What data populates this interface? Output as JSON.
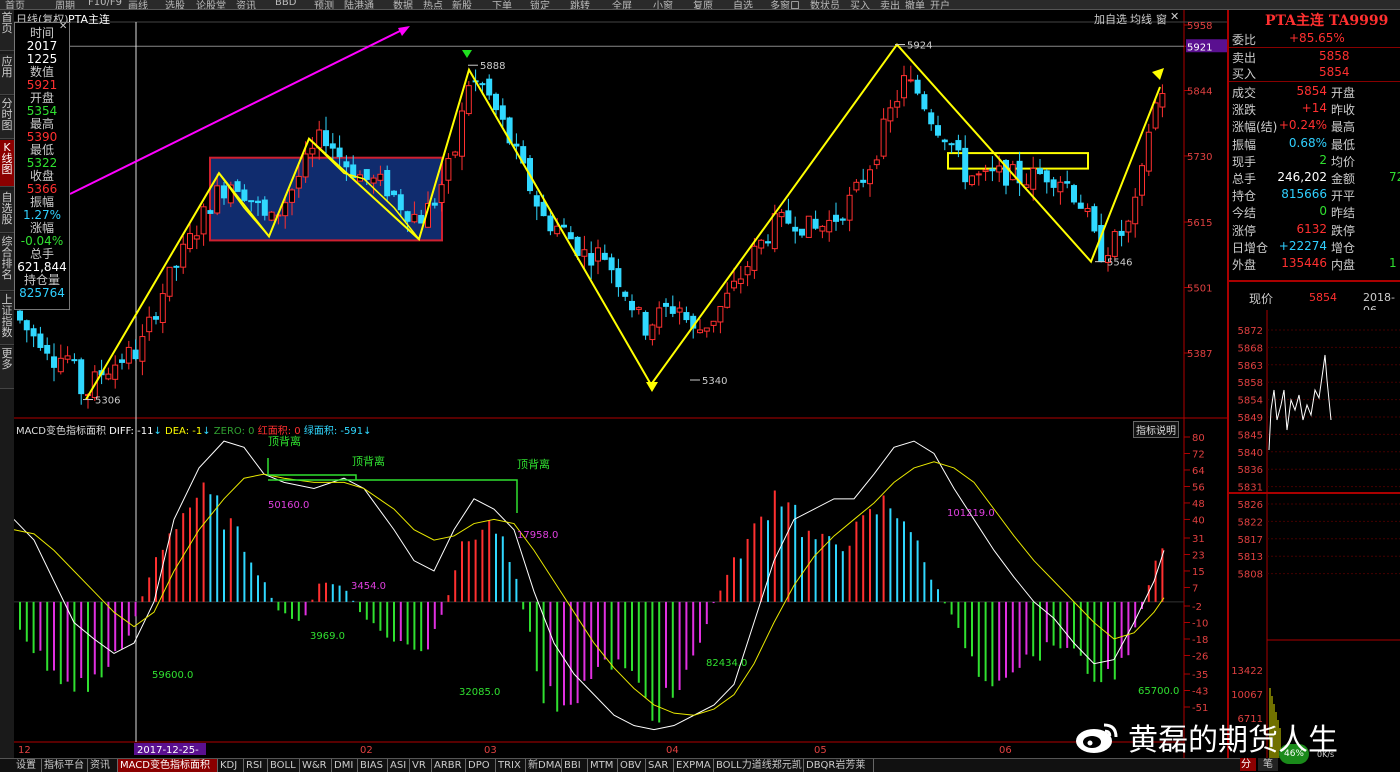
{
  "menubar": {
    "items": [
      "首页",
      "周期",
      "F10/F9",
      "画线",
      "选股",
      "论股堂",
      "资讯",
      "BBD",
      "预测",
      "陆港通",
      "数据",
      "热点",
      "新股",
      "下单",
      "锁定",
      "跳转",
      "全屏",
      "小窗",
      "复原",
      "自选",
      "多窗口",
      "数状员",
      "买入",
      "卖出",
      "撤单",
      "开户"
    ]
  },
  "leftnav": {
    "items": [
      "首页",
      "应用",
      "分时图",
      "K线图",
      "自选股",
      "综合排名",
      "上证指数",
      "更多"
    ]
  },
  "chart_header": {
    "period": "日线(复权)",
    "symbol": "PTA主连",
    "buttons": [
      "加自选",
      "均线",
      "窗"
    ]
  },
  "info_panel": {
    "rows": [
      {
        "label": "时间",
        "value": "2017",
        "color": "#ffffff"
      },
      {
        "label": "",
        "value": "1225",
        "color": "#ffffff"
      },
      {
        "label": "数值",
        "value": "5921",
        "color": "#ff3030"
      },
      {
        "label": "开盘",
        "value": "5354",
        "color": "#30e030"
      },
      {
        "label": "最高",
        "value": "5390",
        "color": "#ff3030"
      },
      {
        "label": "最低",
        "value": "5322",
        "color": "#30e030"
      },
      {
        "label": "收盘",
        "value": "5366",
        "color": "#ff3030"
      },
      {
        "label": "振幅",
        "value": "1.27%",
        "color": "#30d0ff"
      },
      {
        "label": "涨幅",
        "value": "-0.04%",
        "color": "#30e030"
      },
      {
        "label": "总手",
        "value": "621,844",
        "color": "#ffffff"
      },
      {
        "label": "持仓量",
        "value": "825764",
        "color": "#30d0ff"
      }
    ]
  },
  "price_axis": {
    "ticks": [
      "5958",
      "5921",
      "5844",
      "5730",
      "5615",
      "5501",
      "5387"
    ]
  },
  "price_annotations": {
    "high1": "5888",
    "high2": "5924",
    "low1": "5306",
    "low2": "5340",
    "low3": "5546"
  },
  "macd_header": {
    "name": "MACD变色指标面积",
    "diff": "DIFF: -11",
    "dea": "DEA: -1",
    "zero": "ZERO: 0",
    "red_area": "红面积: 0",
    "green_area": "绿面积: -591",
    "explain_button": "指标说明"
  },
  "macd_axis": {
    "ticks": [
      "80",
      "72",
      "64",
      "56",
      "48",
      "40",
      "31",
      "23",
      "15",
      "7",
      "-2",
      "-10",
      "-18",
      "-26",
      "-35",
      "-43",
      "-51"
    ]
  },
  "macd_annotations": {
    "divergence_labels": [
      "顶背离",
      "顶背离",
      "顶背离"
    ],
    "areas": [
      "50160.0",
      "3454.0",
      "17958.0",
      "101219.0",
      "3969.0",
      "59600.0",
      "32085.0",
      "82434.0",
      "65700.0"
    ]
  },
  "time_axis": {
    "labels": [
      "12",
      "2017-12-25",
      "02",
      "03",
      "04",
      "05",
      "06"
    ]
  },
  "right_panel": {
    "title": "PTA主连 TA9999",
    "webi": {
      "label": "委比",
      "value": "+85.65%"
    },
    "sell": {
      "label": "卖出",
      "value": "5858"
    },
    "buy": {
      "label": "买入",
      "value": "5854"
    },
    "grid": [
      {
        "l1": "成交",
        "v1": "5854",
        "l2": "开盘",
        "v1color": "#ff3030"
      },
      {
        "l1": "涨跌",
        "v1": "+14",
        "l2": "昨收",
        "v1color": "#ff3030"
      },
      {
        "l1": "涨幅(结)",
        "v1": "+0.24%",
        "l2": "最高",
        "v1color": "#ff3030"
      },
      {
        "l1": "振幅",
        "v1": "0.68%",
        "l2": "最低",
        "v1color": "#30d0ff"
      },
      {
        "l1": "现手",
        "v1": "2",
        "l2": "均价",
        "v1color": "#30e030"
      },
      {
        "l1": "总手",
        "v1": "246,202",
        "l2": "金额",
        "v1color": "#ffffff",
        "v2": "72"
      },
      {
        "l1": "持仓",
        "v1": "815666",
        "l2": "开平",
        "v1color": "#30d0ff"
      },
      {
        "l1": "今结",
        "v1": "0",
        "l2": "昨结",
        "v1color": "#30e030"
      },
      {
        "l1": "涨停",
        "v1": "6132",
        "l2": "跌停",
        "v1color": "#ff3030"
      },
      {
        "l1": "日增仓",
        "v1": "+22274",
        "l2": "增仓",
        "v1color": "#30d0ff"
      },
      {
        "l1": "外盘",
        "v1": "135446",
        "l2": "内盘",
        "v1color": "#ff3030",
        "v2": "1"
      }
    ],
    "current_label": "现价",
    "current_value": "5854",
    "date_label": "2018-06",
    "mini_axis": [
      "5872",
      "5868",
      "5863",
      "5858",
      "5854",
      "5849",
      "5845",
      "5840",
      "5836",
      "5831",
      "5826",
      "5822",
      "5817",
      "5813",
      "5808"
    ],
    "vol_axis": [
      "13422",
      "10067",
      "6711"
    ],
    "speed": "0K/s",
    "speed_pct": "46%",
    "bottom_tabs": [
      "分",
      "笔"
    ]
  },
  "bottom_tabs": [
    "设置",
    "指标平台",
    "资讯",
    "MACD变色指标面积",
    "KDJ",
    "RSI",
    "BOLL",
    "W&R",
    "DMI",
    "BIAS",
    "ASI",
    "VR",
    "ARBR",
    "DPO",
    "TRIX",
    "新DMA",
    "BBI",
    "MTM",
    "OBV",
    "SAR",
    "EXPMA",
    "BOLL力道线郑元凯",
    "DBQR岩芳莱"
  ],
  "watermark": "黄磊的期货人生",
  "colors": {
    "up": "#ff3030",
    "down": "#30d8ff",
    "axis": "#b00000",
    "annotate": "#ffff00",
    "trend": "#ff00ff",
    "box": "#102c6e"
  }
}
